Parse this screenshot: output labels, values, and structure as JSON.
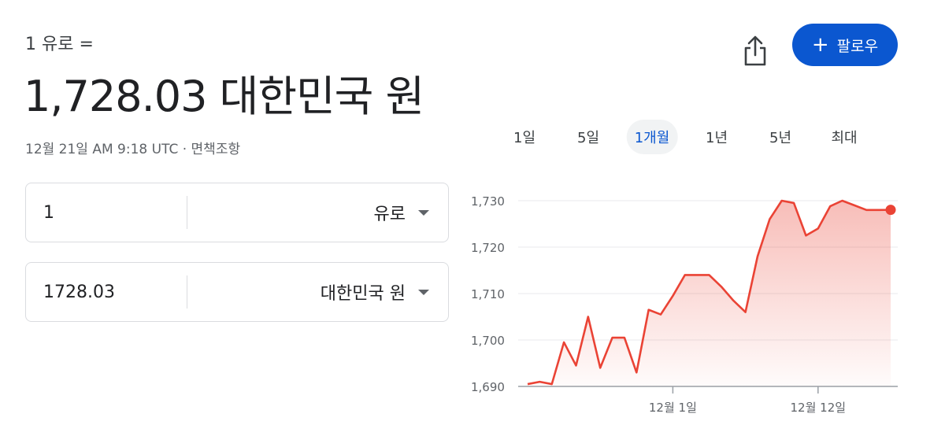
{
  "header": {
    "subtitle": "1 유로 =",
    "rate": "1,728.03 대한민국 원",
    "timestamp": "12월 21일 AM 9:18 UTC · 면책조항"
  },
  "actions": {
    "share_icon": "share-icon",
    "follow_plus": "+",
    "follow_label": "팔로우",
    "follow_color": "#0b57d0"
  },
  "tabs": [
    {
      "label": "1일"
    },
    {
      "label": "5일"
    },
    {
      "label": "1개월",
      "active": true
    },
    {
      "label": "1년"
    },
    {
      "label": "5년"
    },
    {
      "label": "최대"
    }
  ],
  "converter": {
    "from": {
      "value": "1",
      "currency": "유로"
    },
    "to": {
      "value": "1728.03",
      "currency": "대한민국 원"
    }
  },
  "chart_data": {
    "type": "area",
    "color": "#ea4335",
    "ylim": [
      1690,
      1730
    ],
    "yticks": [
      "1,730",
      "1,720",
      "1,710",
      "1,700",
      "1,690"
    ],
    "ytick_values": [
      1730,
      1720,
      1710,
      1700,
      1690
    ],
    "xticks": [
      "12월 1일",
      "12월 12일"
    ],
    "xtick_index": [
      12,
      24
    ],
    "grid": true,
    "values": [
      1690.5,
      1691.0,
      1690.5,
      1699.5,
      1694.5,
      1705.0,
      1694.0,
      1700.5,
      1700.5,
      1693.0,
      1706.5,
      1705.5,
      1709.5,
      1714.0,
      1714.0,
      1714.0,
      1711.5,
      1708.5,
      1706.0,
      1718.0,
      1726.0,
      1730.0,
      1729.5,
      1722.5,
      1724.0,
      1728.8,
      1730.0,
      1729.0,
      1728.0,
      1728.0,
      1728.03
    ]
  }
}
